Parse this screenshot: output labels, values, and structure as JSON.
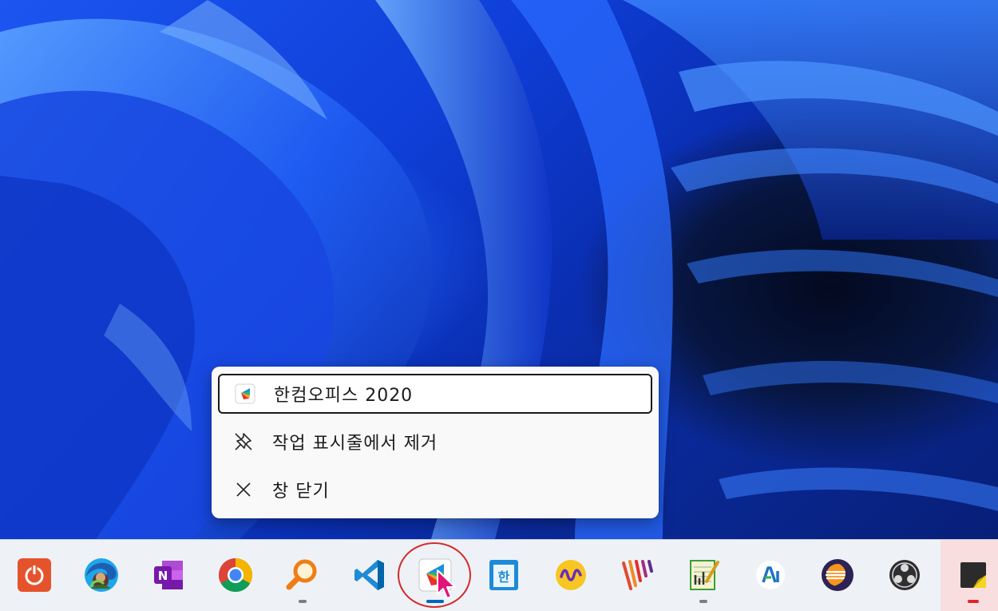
{
  "context_menu": {
    "items": [
      {
        "label": "한컴오피스 2020",
        "icon": "hancom-office-icon"
      },
      {
        "label": "작업 표시줄에서 제거",
        "icon": "unpin-icon"
      },
      {
        "label": "창 닫기",
        "icon": "close-icon"
      }
    ]
  },
  "taskbar": {
    "apps": [
      {
        "name": "power-app",
        "running": false
      },
      {
        "name": "microsoft-edge",
        "running": false
      },
      {
        "name": "onenote",
        "running": false
      },
      {
        "name": "google-chrome",
        "running": false
      },
      {
        "name": "search-magnifier",
        "running": true
      },
      {
        "name": "visual-studio-code",
        "running": false
      },
      {
        "name": "hancom-office-2020",
        "running": true,
        "active": true
      },
      {
        "name": "hangul-word",
        "running": false
      },
      {
        "name": "audio-wave-app",
        "running": false
      },
      {
        "name": "striped-app",
        "running": false
      },
      {
        "name": "notepad-chart",
        "running": true
      },
      {
        "name": "adobe-illustrator-like",
        "running": false
      },
      {
        "name": "eclipse",
        "running": false
      },
      {
        "name": "obs-studio",
        "running": false
      },
      {
        "name": "sticky-notes",
        "running": true,
        "alert": true
      }
    ]
  },
  "colors": {
    "accent": "#0067c0",
    "highlight_circle": "#d32b2b",
    "wallpaper_blue": "#1c55f0"
  }
}
